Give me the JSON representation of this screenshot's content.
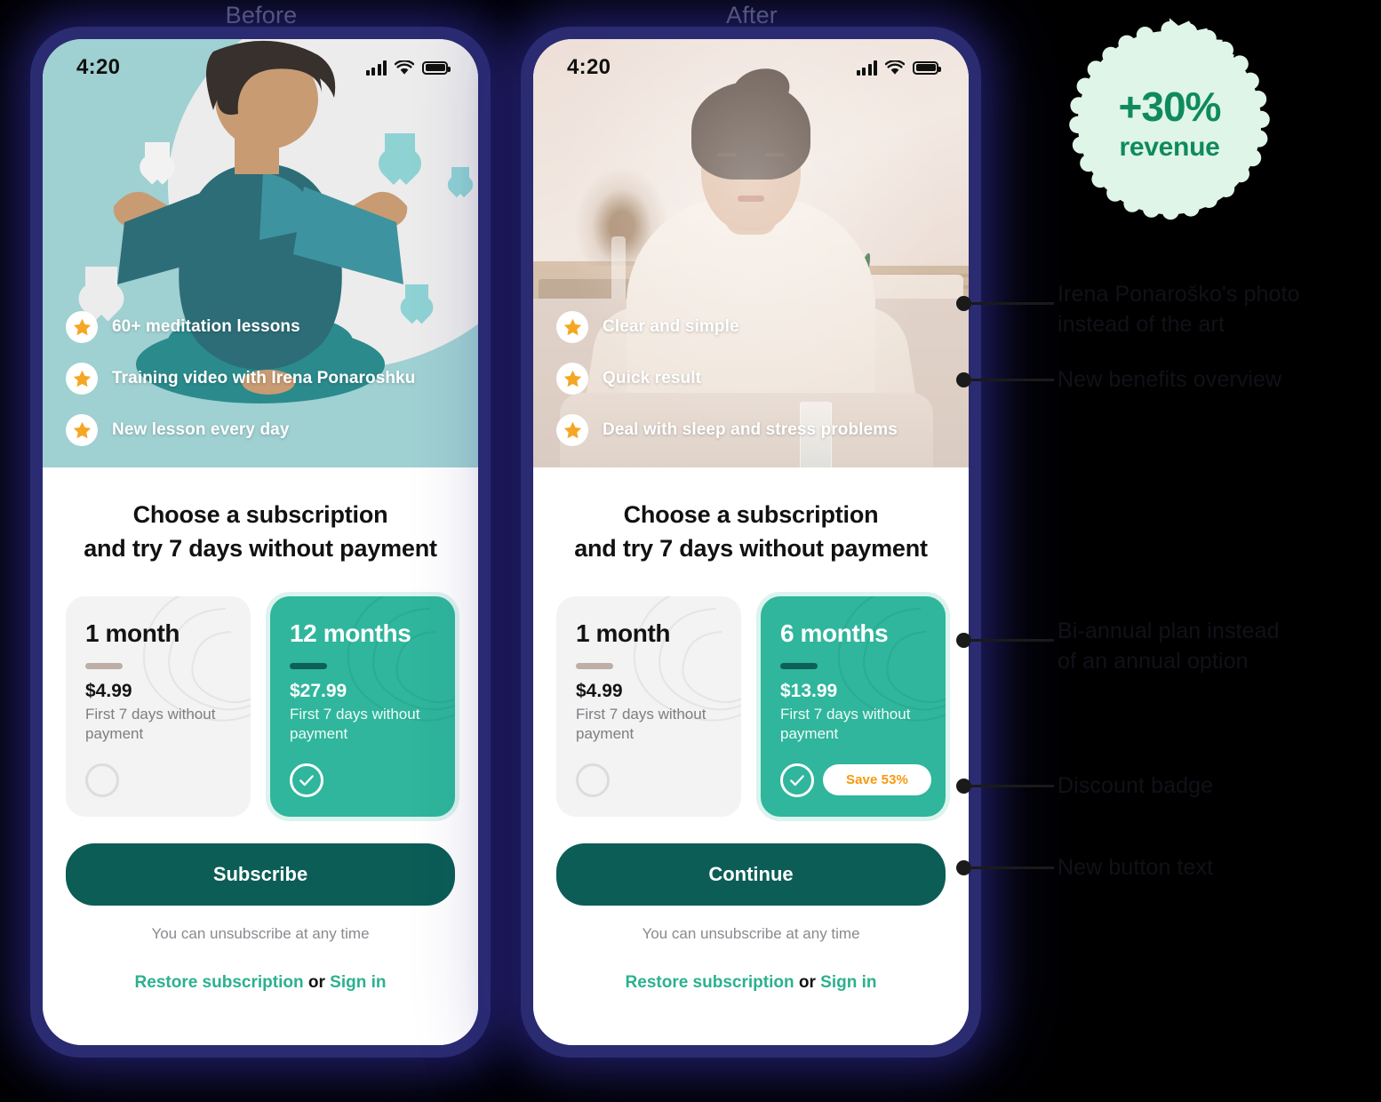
{
  "captions": {
    "before": "Before",
    "after": "After"
  },
  "colors": {
    "phone_frame": "#2b2b72",
    "hero_before": "#9fd0d2",
    "accent_teal": "#2fb69c",
    "cta": "#0b5d56",
    "link_green": "#2bb18e",
    "badge_orange": "#f59a0b",
    "revenue_green": "#0f8a5f",
    "revenue_bg": "#dff5e8"
  },
  "status_bar": {
    "time": "4:20",
    "signal_icon": "cellular-bars-icon",
    "wifi_icon": "wifi-icon",
    "battery_icon": "battery-full-icon"
  },
  "before": {
    "hero_kind": "illustration-meditating-person",
    "benefits": [
      {
        "icon": "star-icon",
        "label": "60+ meditation lessons"
      },
      {
        "icon": "star-icon",
        "label": "Training video with Irena Ponaroshku"
      },
      {
        "icon": "star-icon",
        "label": "New lesson every day"
      }
    ],
    "sheet": {
      "title_line1": "Choose a subscription",
      "title_line2": "and try 7 days without payment",
      "plans": [
        {
          "name": "1 month",
          "price": "$4.99",
          "note": "First 7 days without payment",
          "selected": false,
          "badge": null
        },
        {
          "name": "12 months",
          "price": "$27.99",
          "note": "First 7 days without payment",
          "selected": true,
          "badge": null
        }
      ],
      "cta": "Subscribe",
      "unsubscribe": "You can unsubscribe at any time",
      "restore_link": "Restore subscription",
      "or_text": "or",
      "signin_link": "Sign in"
    }
  },
  "after": {
    "hero_kind": "photo-irena-ponarosku-meditating",
    "benefits": [
      {
        "icon": "star-icon",
        "label": "Clear and simple"
      },
      {
        "icon": "star-icon",
        "label": "Quick result"
      },
      {
        "icon": "star-icon",
        "label": "Deal with sleep and stress problems"
      }
    ],
    "sheet": {
      "title_line1": "Choose a subscription",
      "title_line2": "and try 7 days without payment",
      "plans": [
        {
          "name": "1 month",
          "price": "$4.99",
          "note": "First 7 days without payment",
          "selected": false,
          "badge": null
        },
        {
          "name": "6 months",
          "price": "$13.99",
          "note": "First 7 days without payment",
          "selected": true,
          "badge": "Save 53%"
        }
      ],
      "cta": "Continue",
      "unsubscribe": "You can unsubscribe at any time",
      "restore_link": "Restore subscription",
      "or_text": "or",
      "signin_link": "Sign in"
    }
  },
  "revenue_badge": {
    "value": "+30%",
    "label": "revenue"
  },
  "annotations": [
    {
      "text": "Irena Ponaroško's photo\ninstead of the art"
    },
    {
      "text": "New benefits overview"
    },
    {
      "text": "Bi-annual plan instead\nof an annual option"
    },
    {
      "text": "Discount badge"
    },
    {
      "text": "New button text"
    }
  ]
}
